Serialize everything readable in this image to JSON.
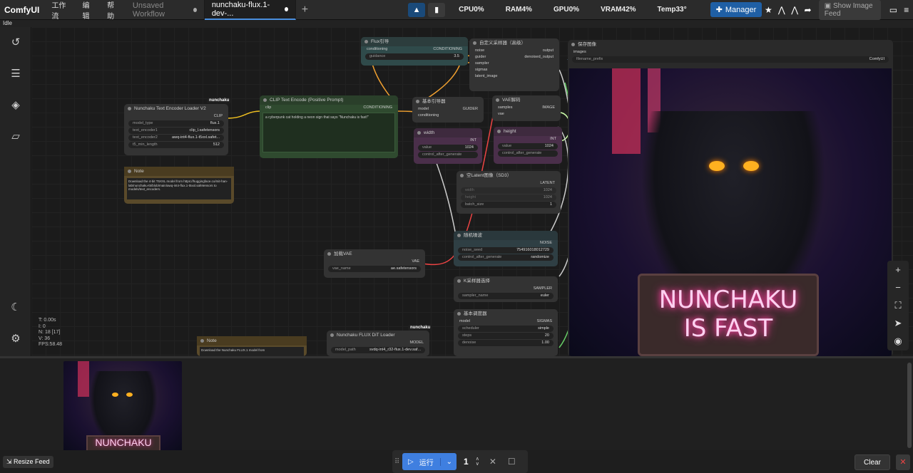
{
  "app": {
    "name": "ComfyUI",
    "status": "Idle"
  },
  "menu": [
    "工作流",
    "编辑",
    "帮助"
  ],
  "tabs": [
    {
      "label": "Unsaved Workflow"
    },
    {
      "label": "nunchaku-flux.1-dev-..."
    }
  ],
  "monitor": {
    "cpu": "CPU0%",
    "ram": "RAM4%",
    "gpu": "GPU0%",
    "vram": "VRAM42%",
    "temp": "Temp33°"
  },
  "toolbar": {
    "manager": "Manager",
    "feed": "Show Image Feed"
  },
  "stats": [
    "T: 0.00s",
    "I: 0",
    "N: 18 [17]",
    "V: 36",
    "FPS:58.48"
  ],
  "nodes": {
    "text_encoder": {
      "badge": "nunchaku",
      "title": "Nunchaku Text Encoder Loader V2",
      "out": "CLIP",
      "widgets": [
        [
          "model_type",
          "flux.1"
        ],
        [
          "text_encoder1",
          "clip_l.safetensors"
        ],
        [
          "text_encoder2",
          "awq-int4-flux.1-t5xxl.safet..."
        ],
        [
          "t5_min_length",
          "512"
        ]
      ]
    },
    "note1": {
      "title": "Note",
      "text": "Download the 4-bit T5XXL model from https://huggingface.co/mit-han-lab/nunchaku-t5/blob/main/awq-int4-flux.1-t5xxl.safetensors to models/text_encoders."
    },
    "clip_encode": {
      "title": "CLIP Text Encode (Positive Prompt)",
      "in": "clip",
      "out": "CONDITIONING",
      "text": "a cyberpunk cat holding a neon sign that says \"Nunchaku is fast!\""
    },
    "flux_guide": {
      "title": "Flux引导",
      "in": "conditioning",
      "out": "CONDITIONING",
      "widget": [
        "guidance",
        "3.5"
      ]
    },
    "custom_sampler": {
      "title": "自定义采样器（高级）",
      "ins": [
        "noise",
        "guider",
        "sampler",
        "sigmas",
        "latent_image"
      ],
      "outs": [
        "output",
        "denoised_output"
      ]
    },
    "basic_guider": {
      "title": "基本引导器",
      "ins": [
        "model",
        "conditioning"
      ],
      "out": "GUIDER"
    },
    "vae_decode": {
      "title": "VAE解码",
      "ins": [
        "samples",
        "vae"
      ],
      "out": "IMAGE"
    },
    "width": {
      "title": "width",
      "out": "INT",
      "widgets": [
        [
          "value",
          "1024"
        ],
        [
          "control_after_generate",
          ""
        ]
      ]
    },
    "height": {
      "title": "height",
      "out": "INT",
      "widgets": [
        [
          "value",
          "1024"
        ],
        [
          "control_after_generate",
          ""
        ]
      ]
    },
    "empty_latent": {
      "title": "空Latent图像（SD3）",
      "out": "LATENT",
      "widgets": [
        [
          "width",
          "1024"
        ],
        [
          "height",
          "1024"
        ],
        [
          "batch_size",
          "1"
        ]
      ]
    },
    "random_noise": {
      "title": "随机噪波",
      "out": "NOISE",
      "widgets": [
        [
          "noise_seed",
          "754916018012729"
        ],
        [
          "control_after_generate",
          "randomize"
        ]
      ]
    },
    "load_vae": {
      "title": "加载VAE",
      "out": "VAE",
      "widgets": [
        [
          "vae_name",
          "ae.safetensors"
        ]
      ]
    },
    "ksampler_select": {
      "title": "K采样器选择",
      "out": "SAMPLER",
      "widgets": [
        [
          "sampler_name",
          "euler"
        ]
      ]
    },
    "basic_scheduler": {
      "title": "基本调度器",
      "in": "model",
      "out": "SIGMAS",
      "widgets": [
        [
          "scheduler",
          "simple"
        ],
        [
          "steps",
          "20"
        ],
        [
          "denoise",
          "1.00"
        ]
      ]
    },
    "dit_loader": {
      "badge": "nunchaku",
      "title": "Nunchaku FLUX DiT Loader",
      "out": "MODEL",
      "widgets": [
        [
          "model_path",
          "svdq-int4_r32-flux.1-dev.saf..."
        ]
      ]
    },
    "note2": {
      "title": "Note",
      "text": "Download the Nunchaku FLUX.1 model from"
    },
    "save_image": {
      "title": "保存图像",
      "in": "images",
      "widgets": [
        [
          "filename_prefix",
          "ComfyUI"
        ]
      ],
      "sign_line1": "NUNCHAKU",
      "sign_line2": "IS FAST"
    }
  },
  "feed": {
    "thumb_sign": "NUNCHAKU",
    "resize": "Resize Feed",
    "clear": "Clear"
  },
  "run": {
    "label": "运行",
    "count": "1"
  },
  "colors": {
    "accent": "#3f7fe0",
    "neon": "#ff4fb0"
  }
}
